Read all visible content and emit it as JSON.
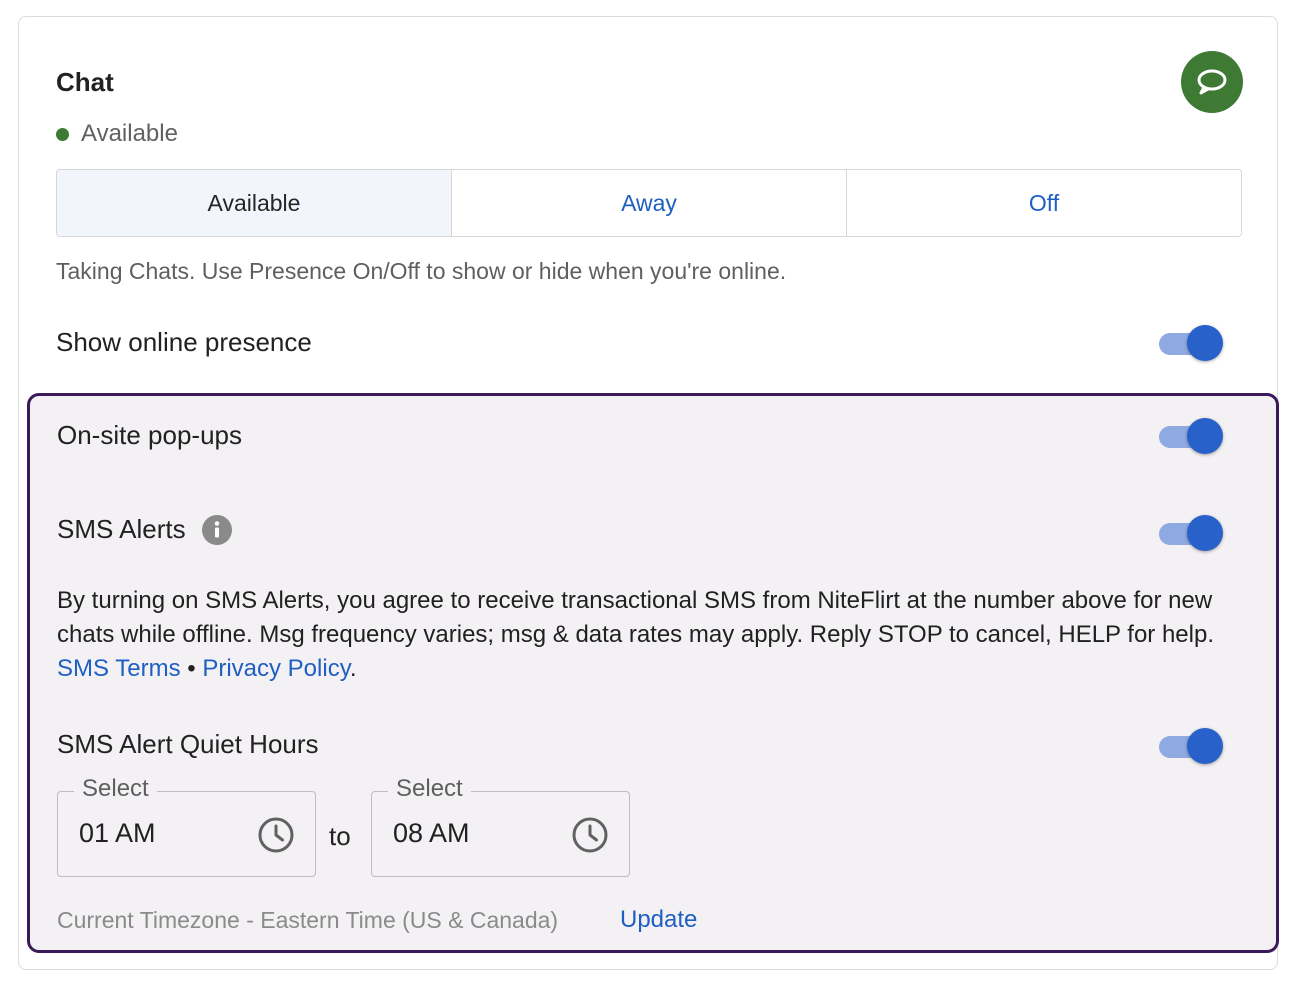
{
  "chat": {
    "title": "Chat",
    "status_text": "Available",
    "tabs": [
      {
        "label": "Available",
        "active": true
      },
      {
        "label": "Away",
        "active": false
      },
      {
        "label": "Off",
        "active": false
      }
    ],
    "help_text": "Taking Chats. Use Presence On/Off to show or hide when you're online.",
    "show_presence_label": "Show online presence",
    "show_presence_on": true
  },
  "panel": {
    "popups_label": "On-site pop-ups",
    "popups_on": true,
    "sms_label": "SMS Alerts",
    "sms_on": true,
    "consent_text": "By turning on SMS Alerts, you agree to receive transactional SMS from NiteFlirt at the number above for new chats while offline. Msg frequency varies; msg & data rates may apply. Reply STOP to cancel, HELP for help.",
    "sms_terms_link": "SMS Terms",
    "separator": "•",
    "privacy_link": "Privacy Policy",
    "period": ".",
    "quiet_hours_label": "SMS Alert Quiet Hours",
    "quiet_hours_on": true,
    "from_field": {
      "label": "Select",
      "value": "01 AM"
    },
    "to_text": "to",
    "to_field": {
      "label": "Select",
      "value": "08 AM"
    },
    "timezone_text": "Current Timezone - Eastern Time (US & Canada)",
    "update_link": "Update"
  },
  "colors": {
    "accent_blue": "#2761c9",
    "link_blue": "#1f5fc2",
    "available_green": "#3d7a34",
    "panel_border": "#3b1a5a"
  },
  "icons": {
    "chat_badge": "chat-bubble-icon",
    "info": "info-icon",
    "clock": "clock-icon"
  }
}
